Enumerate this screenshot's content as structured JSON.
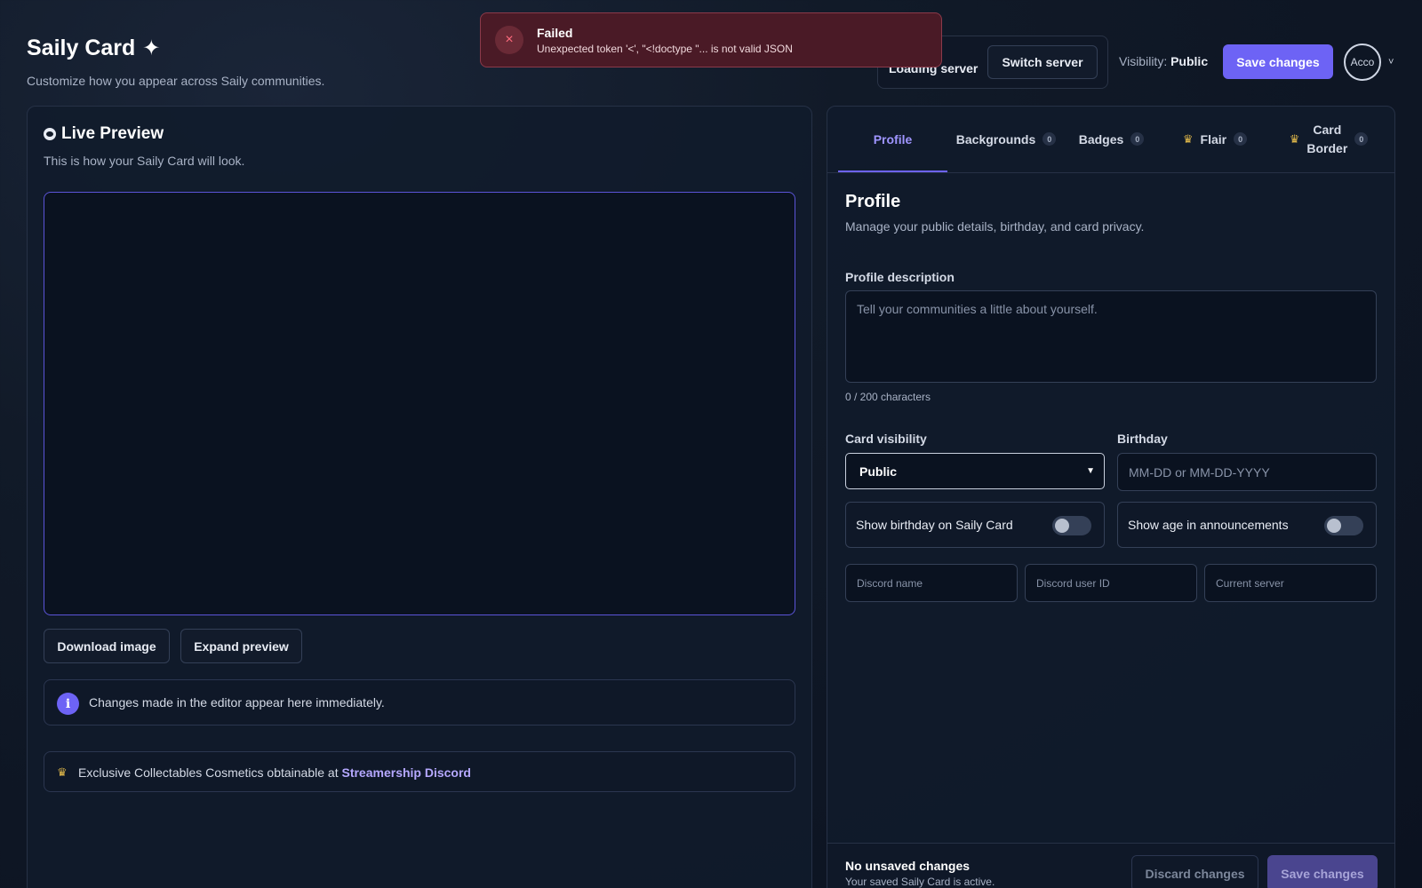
{
  "header": {
    "title": "Saily Card",
    "title_icon": "sparkle-icon",
    "subtitle": "Customize how you appear across Saily communities.",
    "server_status": "Loading server",
    "switch_server_label": "Switch server",
    "visibility_label": "Visibility:",
    "visibility_value": "Public",
    "save_label": "Save changes",
    "avatar_alt": "Acco",
    "avatar_chevron": "˅"
  },
  "toast": {
    "icon": "×",
    "title": "Failed",
    "message": "Unexpected token '<', \"<!doctype \"... is not valid JSON",
    "color": "#4a1a26"
  },
  "preview": {
    "title": "Live Preview",
    "subtitle": "This is how your Saily Card will look.",
    "download_label": "Download image",
    "expand_label": "Expand preview",
    "info_icon": "i",
    "info_text": "Changes made in the editor appear here immediately.",
    "promo_crown": "♛",
    "promo_text": "Exclusive Collectables Cosmetics obtainable at ",
    "promo_link": "Streamership Discord"
  },
  "tabs": [
    {
      "label": "Profile",
      "count": null,
      "active": true
    },
    {
      "label": "Backgrounds",
      "count": "0"
    },
    {
      "label": "Badges",
      "count": "0"
    },
    {
      "label": "Flair",
      "count": "0",
      "crown": "♛"
    },
    {
      "label_line1": "Card",
      "label_line2": "Border",
      "count": "0",
      "crown": "♛"
    }
  ],
  "profile": {
    "title": "Profile",
    "subtitle": "Manage your public details, birthday, and card privacy.",
    "description_label": "Profile description",
    "description_placeholder": "Tell your communities a little about yourself.",
    "char_count": "0 / 200 characters",
    "visibility_label": "Card visibility",
    "visibility_value": "Public",
    "birthday_label": "Birthday",
    "birthday_placeholder": "MM-DD or MM-DD-YYYY",
    "show_birthday_label": "Show birthday on Saily Card",
    "show_age_label": "Show age in announcements",
    "discord_name_placeholder": "Discord name",
    "discord_id_placeholder": "Discord user ID",
    "current_server_placeholder": "Current server"
  },
  "footer": {
    "status_title": "No unsaved changes",
    "status_sub": "Your saved Saily Card is active.",
    "discard_label": "Discard changes",
    "save_label": "Save changes"
  },
  "colors": {
    "accent": "#6d63f5",
    "background": "#0b1220",
    "error": "#ff6b7d"
  }
}
